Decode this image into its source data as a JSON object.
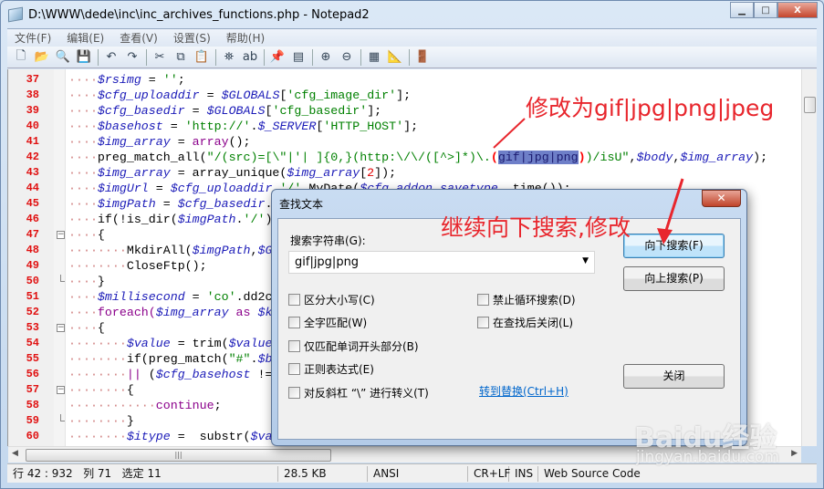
{
  "window": {
    "title": "D:\\WWW\\dede\\inc\\inc_archives_functions.php - Notepad2",
    "minimize": "▁",
    "maximize": "□",
    "close": "X"
  },
  "menu": [
    "文件(F)",
    "编辑(E)",
    "查看(V)",
    "设置(S)",
    "帮助(H)"
  ],
  "toolbar": [
    {
      "icon": "new-file-icon",
      "glyph": "🗋"
    },
    {
      "icon": "open-folder-icon",
      "glyph": "📂"
    },
    {
      "icon": "browse-icon",
      "glyph": "🔍"
    },
    {
      "icon": "save-icon",
      "glyph": "💾"
    },
    {
      "sep": true
    },
    {
      "icon": "undo-icon",
      "glyph": "↶"
    },
    {
      "icon": "redo-icon",
      "glyph": "↷"
    },
    {
      "sep": true
    },
    {
      "icon": "cut-icon",
      "glyph": "✂"
    },
    {
      "icon": "copy-icon",
      "glyph": "⧉"
    },
    {
      "icon": "paste-icon",
      "glyph": "📋"
    },
    {
      "sep": true
    },
    {
      "icon": "find-icon",
      "glyph": "⛯"
    },
    {
      "icon": "replace-icon",
      "glyph": "ab"
    },
    {
      "sep": true
    },
    {
      "icon": "favorites-icon",
      "glyph": "📌"
    },
    {
      "icon": "goto-icon",
      "glyph": "▤"
    },
    {
      "sep": true
    },
    {
      "icon": "zoom-in-icon",
      "glyph": "⊕"
    },
    {
      "icon": "zoom-out-icon",
      "glyph": "⊖"
    },
    {
      "sep": true
    },
    {
      "icon": "scheme-icon",
      "glyph": "▦"
    },
    {
      "icon": "customize-scheme-icon",
      "glyph": "📐"
    },
    {
      "sep": true
    },
    {
      "icon": "exit-icon",
      "glyph": "🚪"
    }
  ],
  "editor": {
    "lines": [
      {
        "n": "37",
        "t": [
          [
            "····",
            "ws"
          ],
          [
            "$rsimg",
            "v"
          ],
          [
            " = ",
            ""
          ],
          [
            "''",
            "s"
          ],
          [
            ";",
            ""
          ]
        ]
      },
      {
        "n": "38",
        "t": [
          [
            "····",
            "ws"
          ],
          [
            "$cfg_uploaddir",
            "v"
          ],
          [
            " = ",
            ""
          ],
          [
            "$GLOBALS",
            "v"
          ],
          [
            "[",
            ""
          ],
          [
            "'cfg_image_dir'",
            "s"
          ],
          [
            "];",
            ""
          ]
        ]
      },
      {
        "n": "39",
        "t": [
          [
            "····",
            "ws"
          ],
          [
            "$cfg_basedir",
            "v"
          ],
          [
            " = ",
            ""
          ],
          [
            "$GLOBALS",
            "v"
          ],
          [
            "[",
            ""
          ],
          [
            "'cfg_basedir'",
            "s"
          ],
          [
            "];",
            ""
          ]
        ]
      },
      {
        "n": "40",
        "t": [
          [
            "····",
            "ws"
          ],
          [
            "$basehost",
            "v"
          ],
          [
            " = ",
            ""
          ],
          [
            "'http://'",
            "s"
          ],
          [
            ".",
            ""
          ],
          [
            "$_SERVER",
            "v"
          ],
          [
            "[",
            ""
          ],
          [
            "'HTTP_HOST'",
            "s"
          ],
          [
            "];",
            ""
          ]
        ]
      },
      {
        "n": "41",
        "t": [
          [
            "····",
            "ws"
          ],
          [
            "$img_array",
            "v"
          ],
          [
            " = ",
            ""
          ],
          [
            "array",
            "k"
          ],
          [
            "();",
            ""
          ]
        ]
      },
      {
        "n": "42",
        "t": [
          [
            "····",
            "ws"
          ],
          [
            "preg_match_all(",
            ""
          ],
          [
            "\"/(src)=[\\\"|'| ]{0,}(http:\\/\\/([^>]*)\\.",
            "s"
          ],
          [
            "(",
            "r"
          ],
          [
            "gif|jpg|png",
            "sel"
          ],
          [
            ")",
            "r"
          ],
          [
            ")/isU\"",
            "s"
          ],
          [
            ",",
            ""
          ],
          [
            "$body",
            "v"
          ],
          [
            ",",
            ""
          ],
          [
            "$img_array",
            "v"
          ],
          [
            ");",
            ""
          ]
        ]
      },
      {
        "n": "43",
        "t": [
          [
            "····",
            "ws"
          ],
          [
            "$img_array",
            "v"
          ],
          [
            " = array_unique(",
            ""
          ],
          [
            "$img_array",
            "v"
          ],
          [
            "[",
            ""
          ],
          [
            "2",
            "n"
          ],
          [
            "]);",
            ""
          ]
        ]
      },
      {
        "n": "44",
        "t": [
          [
            "····",
            "ws"
          ],
          [
            "$imgUrl",
            "v"
          ],
          [
            " = ",
            ""
          ],
          [
            "$cfg_uploaddir",
            "v"
          ],
          [
            ".",
            ""
          ],
          [
            "'/'",
            "s"
          ],
          [
            ".MyDate(",
            ""
          ],
          [
            "$cfg_addon_savetype",
            "v"
          ],
          [
            ", time());",
            ""
          ]
        ]
      },
      {
        "n": "45",
        "t": [
          [
            "····",
            "ws"
          ],
          [
            "$imgPath",
            "v"
          ],
          [
            " = ",
            ""
          ],
          [
            "$cfg_basedir",
            "v"
          ],
          [
            ".",
            ""
          ]
        ]
      },
      {
        "n": "46",
        "t": [
          [
            "····",
            "ws"
          ],
          [
            "if(!is_dir(",
            ""
          ],
          [
            "$imgPath",
            "v"
          ],
          [
            ".",
            ""
          ],
          [
            "'/'",
            "s"
          ],
          [
            ")",
            ""
          ]
        ]
      },
      {
        "n": "47",
        "t": [
          [
            "····",
            "ws"
          ],
          [
            "{",
            ""
          ]
        ],
        "fold": "box"
      },
      {
        "n": "48",
        "t": [
          [
            "········",
            "ws"
          ],
          [
            "MkdirAll(",
            ""
          ],
          [
            "$imgPath",
            "v"
          ],
          [
            ",",
            ""
          ],
          [
            "$G",
            "v"
          ]
        ]
      },
      {
        "n": "49",
        "t": [
          [
            "········",
            "ws"
          ],
          [
            "CloseFtp();",
            ""
          ]
        ]
      },
      {
        "n": "50",
        "t": [
          [
            "····",
            "ws"
          ],
          [
            "}",
            ""
          ]
        ],
        "fold": "end"
      },
      {
        "n": "51",
        "t": [
          [
            "····",
            "ws"
          ],
          [
            "$millisecond",
            "v"
          ],
          [
            " = ",
            ""
          ],
          [
            "'co'",
            "s"
          ],
          [
            ".dd2c",
            ""
          ]
        ]
      },
      {
        "n": "52",
        "t": [
          [
            "····",
            "ws"
          ],
          [
            "foreach(",
            "k"
          ],
          [
            "$img_array",
            "v"
          ],
          [
            " as ",
            "k"
          ],
          [
            "$k",
            "v"
          ]
        ]
      },
      {
        "n": "53",
        "t": [
          [
            "····",
            "ws"
          ],
          [
            "{",
            ""
          ]
        ],
        "fold": "box"
      },
      {
        "n": "54",
        "t": [
          [
            "········",
            "ws"
          ],
          [
            "$value",
            "v"
          ],
          [
            " = trim(",
            ""
          ],
          [
            "$value",
            "v"
          ]
        ]
      },
      {
        "n": "55",
        "t": [
          [
            "········",
            "ws"
          ],
          [
            "if(preg_match(",
            ""
          ],
          [
            "\"#\"",
            "s"
          ],
          [
            ".",
            ""
          ],
          [
            "$b",
            "v"
          ]
        ]
      },
      {
        "n": "56",
        "t": [
          [
            "········",
            "ws"
          ],
          [
            "||",
            "k"
          ],
          [
            " (",
            ""
          ],
          [
            "$cfg_basehost",
            "v"
          ],
          [
            " !=",
            ""
          ]
        ]
      },
      {
        "n": "57",
        "t": [
          [
            "········",
            "ws"
          ],
          [
            "{",
            ""
          ]
        ],
        "fold": "box"
      },
      {
        "n": "58",
        "t": [
          [
            "············",
            "ws"
          ],
          [
            "continue",
            "k"
          ],
          [
            ";",
            ""
          ]
        ]
      },
      {
        "n": "59",
        "t": [
          [
            "········",
            "ws"
          ],
          [
            "}",
            ""
          ]
        ],
        "fold": "end"
      },
      {
        "n": "60",
        "t": [
          [
            "········",
            "ws"
          ],
          [
            "$itype",
            "v"
          ],
          [
            " =  substr(",
            ""
          ],
          [
            "$va",
            "v"
          ]
        ]
      }
    ]
  },
  "status": [
    "行 42 : 932   列 71   选定 11",
    "28.5 KB",
    "ANSI",
    "CR+LF",
    "INS",
    "Web Source Code"
  ],
  "dialog": {
    "title": "查找文本",
    "close": "✕",
    "search_label": "搜索字符串(G):",
    "search_value": "gif|jpg|png",
    "options": [
      "区分大小写(C)",
      "全字匹配(W)",
      "仅匹配单词开头部分(B)",
      "正则表达式(E)",
      "对反斜杠 “\\” 进行转义(T)",
      "禁止循环搜索(D)",
      "在查找后关闭(L)"
    ],
    "find_next": "向下搜索(F)",
    "find_prev": "向上搜索(P)",
    "close_button": "关闭",
    "goto_replace": "转到替换(Ctrl+H)"
  },
  "annotations": {
    "top": "修改为gif|jpg|png|jpeg",
    "middle": "继续向下搜索,修改",
    "color": "#e8262d"
  },
  "watermark": {
    "logo": "Baidu经验",
    "url": "jingyan.baidu.com"
  }
}
